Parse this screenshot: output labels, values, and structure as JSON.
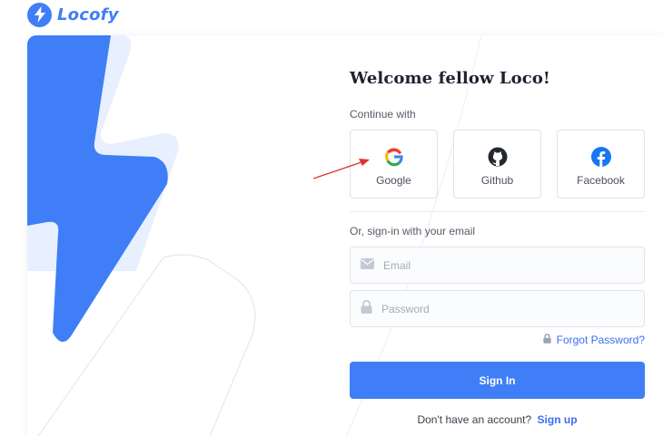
{
  "brand": {
    "name": "Locofy",
    "color": "#3f7ef6"
  },
  "login": {
    "title": "Welcome fellow Loco!",
    "continue_label": "Continue with",
    "social": [
      {
        "label": "Google",
        "icon": "google-icon"
      },
      {
        "label": "Github",
        "icon": "github-icon"
      },
      {
        "label": "Facebook",
        "icon": "facebook-icon"
      }
    ],
    "email_section_label": "Or, sign-in with your email",
    "email_placeholder": "Email",
    "password_placeholder": "Password",
    "forgot_label": "Forgot Password?",
    "signin_label": "Sign In",
    "signup_prompt": "Don't have an account?",
    "signup_link": "Sign up"
  },
  "colors": {
    "accent": "#3f7ef6",
    "link": "#3b6ef0",
    "annotation_arrow": "#e0322c"
  }
}
